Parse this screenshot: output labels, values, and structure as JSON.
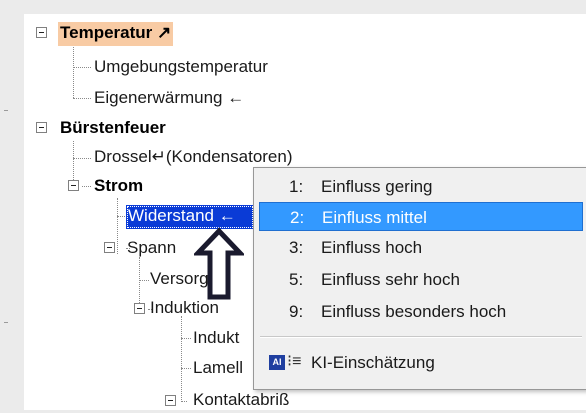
{
  "tree": {
    "nodes": [
      {
        "id": "temperatur",
        "label": "Temperatur ↗"
      },
      {
        "id": "umgebungstemperatur",
        "label": "Umgebungstemperatur"
      },
      {
        "id": "eigenerwaermung",
        "label": "Eigenerwärmung ←"
      },
      {
        "id": "buerstenfeuer",
        "label": "Bürstenfeuer"
      },
      {
        "id": "drossel",
        "label": "Drossel↵(Kondensatoren)"
      },
      {
        "id": "strom",
        "label": "Strom"
      },
      {
        "id": "widerstand",
        "label": "Widerstand ←"
      },
      {
        "id": "spannung",
        "label": "Spann"
      },
      {
        "id": "versorgung",
        "label": "Versorgun"
      },
      {
        "id": "induktion",
        "label": "Induktion"
      },
      {
        "id": "induktivitaet",
        "label": "Indukt"
      },
      {
        "id": "lamelle",
        "label": "Lamell"
      },
      {
        "id": "kontaktabriss",
        "label": "Kontaktabriß"
      }
    ]
  },
  "context_menu": {
    "items": [
      {
        "number": "1:",
        "label": "Einfluss gering",
        "selected": false
      },
      {
        "number": "2:",
        "label": "Einfluss mittel",
        "selected": true
      },
      {
        "number": "3:",
        "label": "Einfluss hoch",
        "selected": false
      },
      {
        "number": "5:",
        "label": "Einfluss sehr hoch",
        "selected": false
      },
      {
        "number": "9:",
        "label": "Einfluss besonders hoch",
        "selected": false
      }
    ],
    "ki_item": {
      "label": "KI-Einschätzung",
      "icon": "ai-assessment-icon"
    }
  },
  "colors": {
    "highlight_orange": "#f8cba4",
    "selection_blue": "#0a3bd6",
    "menu_selection": "#3399ff"
  }
}
